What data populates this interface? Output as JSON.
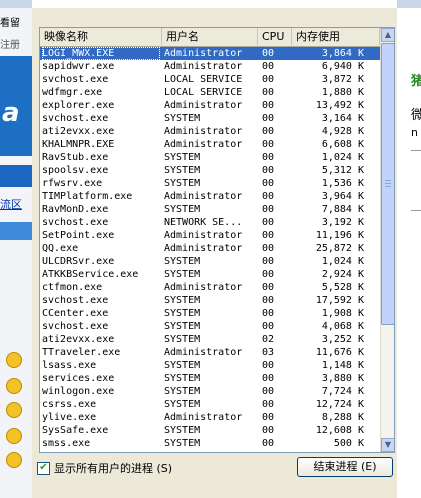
{
  "columns": {
    "name": "映像名称",
    "user": "用户名",
    "cpu": "CPU",
    "mem": "内存使用"
  },
  "processes": [
    {
      "name": "LOGI_MWX.EXE",
      "user": "Administrator",
      "cpu": "00",
      "mem": "3,864 K",
      "selected": true
    },
    {
      "name": "sapidwvr.exe",
      "user": "Administrator",
      "cpu": "00",
      "mem": "6,940 K"
    },
    {
      "name": "svchost.exe",
      "user": "LOCAL SERVICE",
      "cpu": "00",
      "mem": "3,872 K"
    },
    {
      "name": "wdfmgr.exe",
      "user": "LOCAL SERVICE",
      "cpu": "00",
      "mem": "1,880 K"
    },
    {
      "name": "explorer.exe",
      "user": "Administrator",
      "cpu": "00",
      "mem": "13,492 K"
    },
    {
      "name": "svchost.exe",
      "user": "SYSTEM",
      "cpu": "00",
      "mem": "3,164 K"
    },
    {
      "name": "ati2evxx.exe",
      "user": "Administrator",
      "cpu": "00",
      "mem": "4,928 K"
    },
    {
      "name": "KHALMNPR.EXE",
      "user": "Administrator",
      "cpu": "00",
      "mem": "6,608 K"
    },
    {
      "name": "RavStub.exe",
      "user": "SYSTEM",
      "cpu": "00",
      "mem": "1,024 K"
    },
    {
      "name": "spoolsv.exe",
      "user": "SYSTEM",
      "cpu": "00",
      "mem": "5,312 K"
    },
    {
      "name": "rfwsrv.exe",
      "user": "SYSTEM",
      "cpu": "00",
      "mem": "1,536 K"
    },
    {
      "name": "TIMPlatform.exe",
      "user": "Administrator",
      "cpu": "00",
      "mem": "3,964 K"
    },
    {
      "name": "RavMonD.exe",
      "user": "SYSTEM",
      "cpu": "00",
      "mem": "7,884 K"
    },
    {
      "name": "svchost.exe",
      "user": "NETWORK SE...",
      "cpu": "00",
      "mem": "3,192 K"
    },
    {
      "name": "SetPoint.exe",
      "user": "Administrator",
      "cpu": "00",
      "mem": "11,196 K"
    },
    {
      "name": "QQ.exe",
      "user": "Administrator",
      "cpu": "00",
      "mem": "25,872 K"
    },
    {
      "name": "ULCDRSvr.exe",
      "user": "SYSTEM",
      "cpu": "00",
      "mem": "1,024 K"
    },
    {
      "name": "ATKKBService.exe",
      "user": "SYSTEM",
      "cpu": "00",
      "mem": "2,924 K"
    },
    {
      "name": "ctfmon.exe",
      "user": "Administrator",
      "cpu": "00",
      "mem": "5,528 K"
    },
    {
      "name": "svchost.exe",
      "user": "SYSTEM",
      "cpu": "00",
      "mem": "17,592 K"
    },
    {
      "name": "CCenter.exe",
      "user": "SYSTEM",
      "cpu": "00",
      "mem": "1,908 K"
    },
    {
      "name": "svchost.exe",
      "user": "SYSTEM",
      "cpu": "00",
      "mem": "4,068 K"
    },
    {
      "name": "ati2evxx.exe",
      "user": "SYSTEM",
      "cpu": "02",
      "mem": "3,252 K"
    },
    {
      "name": "TTraveler.exe",
      "user": "Administrator",
      "cpu": "03",
      "mem": "11,676 K"
    },
    {
      "name": "lsass.exe",
      "user": "SYSTEM",
      "cpu": "00",
      "mem": "1,148 K"
    },
    {
      "name": "services.exe",
      "user": "SYSTEM",
      "cpu": "00",
      "mem": "3,880 K"
    },
    {
      "name": "winlogon.exe",
      "user": "SYSTEM",
      "cpu": "00",
      "mem": "7,724 K"
    },
    {
      "name": "csrss.exe",
      "user": "SYSTEM",
      "cpu": "00",
      "mem": "12,724 K"
    },
    {
      "name": "ylive.exe",
      "user": "Administrator",
      "cpu": "00",
      "mem": "8,288 K"
    },
    {
      "name": "SysSafe.exe",
      "user": "SYSTEM",
      "cpu": "00",
      "mem": "12,608 K"
    },
    {
      "name": "smss.exe",
      "user": "SYSTEM",
      "cpu": "00",
      "mem": "500 K"
    }
  ],
  "show_all_users": {
    "label": "显示所有用户的进程",
    "hotkey": "(S)",
    "checked": true
  },
  "end_process_button": {
    "label": "结束进程",
    "hotkey": "(E)"
  },
  "background": {
    "left_texts": [
      "看留",
      "注册"
    ],
    "left_banner": "a",
    "left_link": "流区",
    "right_texts": [
      "猪",
      "微",
      "n"
    ]
  },
  "colors": {
    "selection": "#316ac5",
    "panel": "#ece9d8",
    "border": "#7f9db9"
  }
}
